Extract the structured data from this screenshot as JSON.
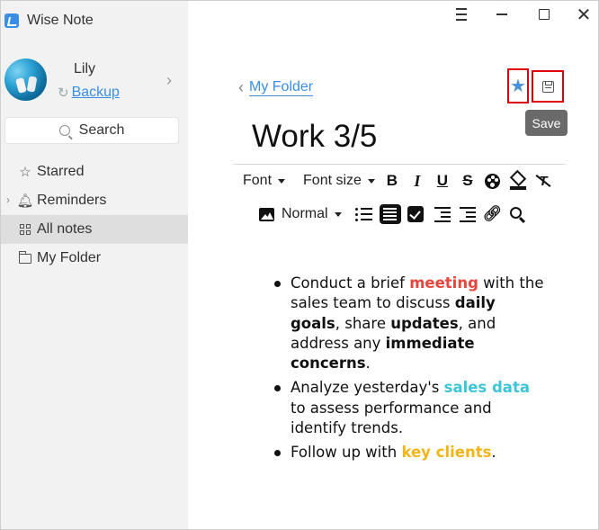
{
  "app": {
    "name": "Wise Note"
  },
  "user": {
    "name": "Lily",
    "backup_label": "Backup"
  },
  "sidebar": {
    "search_label": "Search",
    "items": [
      {
        "label": "Starred",
        "icon": "star-outline-icon"
      },
      {
        "label": "Reminders",
        "icon": "bell-icon"
      },
      {
        "label": "All notes",
        "icon": "grid-icon",
        "active": true
      },
      {
        "label": "My Folder",
        "icon": "folder-icon"
      }
    ]
  },
  "editor": {
    "breadcrumb": "My Folder",
    "title": "Work 3/5",
    "save_tooltip": "Save",
    "toolbar": {
      "font_label": "Font",
      "font_size_label": "Font size",
      "paragraph_style": "Normal"
    },
    "content": {
      "item1": {
        "t1": "Conduct a brief ",
        "meeting": "meeting",
        "t2": " with the sales team to discuss ",
        "daily_goals": "daily goals",
        "t3": ", share ",
        "updates": "updates",
        "t4": ", and address any ",
        "immediate_concerns": "immediate concerns",
        "t5": "."
      },
      "item2": {
        "t1": "Analyze yesterday's ",
        "sales_data": "sales data",
        "t2": " to assess performance and identify trends."
      },
      "item3": {
        "t1": "Follow up with ",
        "key_clients": "key clients",
        "t2": "."
      }
    }
  },
  "colors": {
    "accent": "#3a8ee6",
    "highlight_red": "#e8453c",
    "highlight_cyan": "#3cc5d8",
    "highlight_amber": "#f3b418",
    "annotation_box": "#e0000b"
  }
}
